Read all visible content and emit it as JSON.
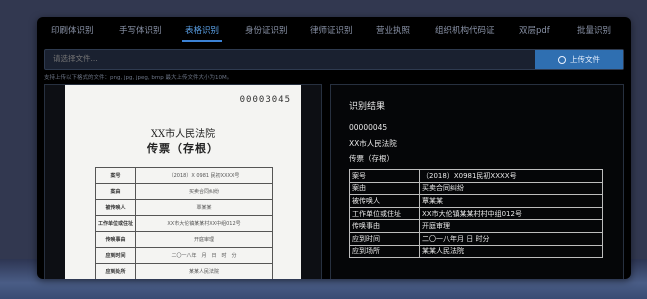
{
  "tabs": [
    {
      "label": "印刷体识别",
      "active": false
    },
    {
      "label": "手写体识别",
      "active": false
    },
    {
      "label": "表格识别",
      "active": true
    },
    {
      "label": "身份证识别",
      "active": false
    },
    {
      "label": "律师证识别",
      "active": false
    },
    {
      "label": "营业执照",
      "active": false
    },
    {
      "label": "组织机构代码证",
      "active": false
    },
    {
      "label": "双层pdf",
      "active": false
    },
    {
      "label": "批量识别",
      "active": false
    }
  ],
  "file": {
    "placeholder": "请选择文件...",
    "upload_label": "上传文件",
    "hint": "支持上传以下格式的文件：png, jpg, jpeg, bmp 最大上传文件大小为10M。"
  },
  "document": {
    "number": "00003045",
    "court": "XX市人民法院",
    "title": "传票（存根）",
    "rows": [
      {
        "k": "案号",
        "v": "（2018）X 0981 民初XXXX号"
      },
      {
        "k": "案由",
        "v": "买卖合同纠纷"
      },
      {
        "k": "被传唤人",
        "v": "覃某某"
      },
      {
        "k": "工作单位或住址",
        "v": "XX市大伦镇某某村XX中组012号"
      },
      {
        "k": "传唤事由",
        "v": "开庭审理"
      },
      {
        "k": "应到时间",
        "v": "二〇一八年　月　日　时　分"
      },
      {
        "k": "应到处所",
        "v": "某某人民法院"
      }
    ]
  },
  "result": {
    "heading": "识别结果",
    "number": "00000045",
    "court": "XX市人民法院",
    "title": "传票（存根）",
    "rows": [
      {
        "k": "案号",
        "v": "（2018）X0981民初XXXX号"
      },
      {
        "k": "案由",
        "v": "买卖合同纠纷"
      },
      {
        "k": "被传唤人",
        "v": "覃某某"
      },
      {
        "k": "工作单位或住址",
        "v": "XX市大伦镇某某村村中组012号"
      },
      {
        "k": "传唤事由",
        "v": "开庭审理"
      },
      {
        "k": "应到时间",
        "v": "二〇一八年月 日 时分"
      },
      {
        "k": "应到场所",
        "v": "某某人民法院"
      }
    ]
  }
}
